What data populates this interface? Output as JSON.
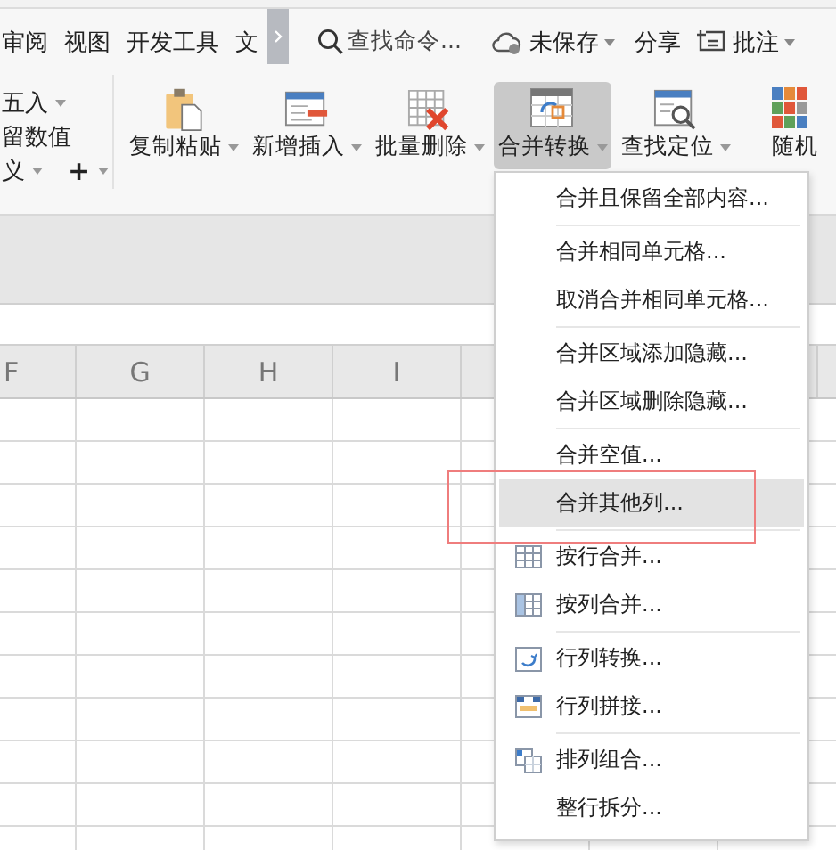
{
  "menubar": {
    "tabs": [
      {
        "label": "审阅",
        "selected": false
      },
      {
        "label": "视图",
        "selected": false
      },
      {
        "label": "开发工具",
        "selected": false
      },
      {
        "label": "文",
        "selected": false
      }
    ],
    "search": {
      "placeholder": "查找命令..."
    },
    "save_status": "未保存",
    "share": "分享",
    "comment": "批注"
  },
  "ribbon": {
    "left_rows": [
      {
        "label": "五入",
        "kind": "dropdown"
      },
      {
        "label": "留数值",
        "kind": "plain"
      },
      {
        "label": "义",
        "kind": "dropdown"
      }
    ],
    "add_button": "+",
    "tools": [
      {
        "label": "复制粘贴",
        "selected": false
      },
      {
        "label": "新增插入",
        "selected": false
      },
      {
        "label": "批量删除",
        "selected": false
      },
      {
        "label": "合并转换",
        "selected": true
      },
      {
        "label": "查找定位",
        "selected": false
      }
    ],
    "cut_tool": "随机"
  },
  "sheet": {
    "columns": [
      "F",
      "G",
      "H",
      "I"
    ]
  },
  "dropdown": {
    "groups": [
      [
        {
          "label": "合并且保留全部内容...",
          "kind": "plain",
          "selected": false
        }
      ],
      [
        {
          "label": "合并相同单元格...",
          "kind": "plain",
          "selected": false
        },
        {
          "label": "取消合并相同单元格...",
          "kind": "plain",
          "selected": false
        }
      ],
      [
        {
          "label": "合并区域添加隐藏...",
          "kind": "plain",
          "selected": false
        },
        {
          "label": "合并区域删除隐藏...",
          "kind": "plain",
          "selected": false
        }
      ],
      [
        {
          "label": "合并空值...",
          "kind": "plain",
          "selected": false
        },
        {
          "label": "合并其他列...",
          "kind": "plain",
          "selected": true
        }
      ],
      [
        {
          "label": "按行合并...",
          "kind": "icon",
          "selected": false
        },
        {
          "label": "按列合并...",
          "kind": "icon",
          "selected": false
        }
      ],
      [
        {
          "label": "行列转换...",
          "kind": "icon",
          "selected": false
        },
        {
          "label": "行列拼接...",
          "kind": "icon",
          "selected": false
        }
      ],
      [
        {
          "label": "排列组合...",
          "kind": "icon",
          "selected": false
        },
        {
          "label": "整行拆分...",
          "kind": "plain",
          "selected": false
        }
      ]
    ]
  }
}
